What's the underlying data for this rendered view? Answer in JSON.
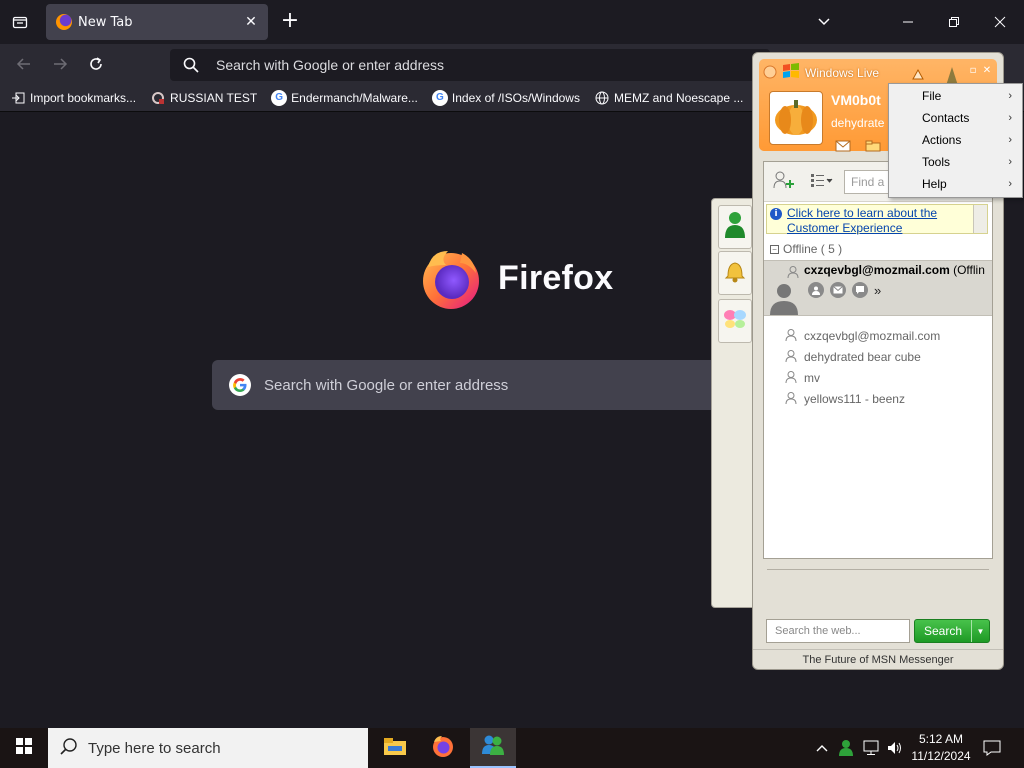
{
  "browser": {
    "tab": {
      "title": "New Tab"
    },
    "urlbar": {
      "placeholder": "Search with Google or enter address"
    },
    "bookmarks": [
      {
        "label": "Import bookmarks...",
        "icon": "import-icon"
      },
      {
        "label": "RUSSIAN TEST",
        "icon": "site-favicon"
      },
      {
        "label": "Endermanch/Malware...",
        "icon": "google-icon"
      },
      {
        "label": "Index of /ISOs/Windows",
        "icon": "google-icon"
      },
      {
        "label": "MEMZ and Noescape ...",
        "icon": "globe-icon"
      }
    ]
  },
  "newtab": {
    "brand": "Firefox",
    "search_placeholder": "Search with Google or enter address"
  },
  "messenger": {
    "title": "Windows Live",
    "user_name": "VM0b0t",
    "personal_message": "dehydrate",
    "find_placeholder": "Find a",
    "banner_text": "Click here to learn about the Customer Experience",
    "group_label": "Offline ( 5 )",
    "expanded_contact": {
      "email": "cxzqevbgl@mozmail.com",
      "status": "(Offlin"
    },
    "contacts": [
      "cxzqevbgl@mozmail.com",
      "dehydrated bear cube",
      "mv",
      "yellows111 - beenz"
    ],
    "web_search_placeholder": "Search the web...",
    "search_button": "Search",
    "footer": "The Future of MSN Messenger",
    "menu": [
      "File",
      "Contacts",
      "Actions",
      "Tools",
      "Help"
    ]
  },
  "taskbar": {
    "search_placeholder": "Type here to search",
    "time": "5:12 AM",
    "date": "11/12/2024"
  },
  "colors": {
    "firefox_bg": "#1c1b22",
    "toolbar_bg": "#2b2a33",
    "msn_orange": "#ff9a35",
    "msn_green": "#1e9a25"
  }
}
